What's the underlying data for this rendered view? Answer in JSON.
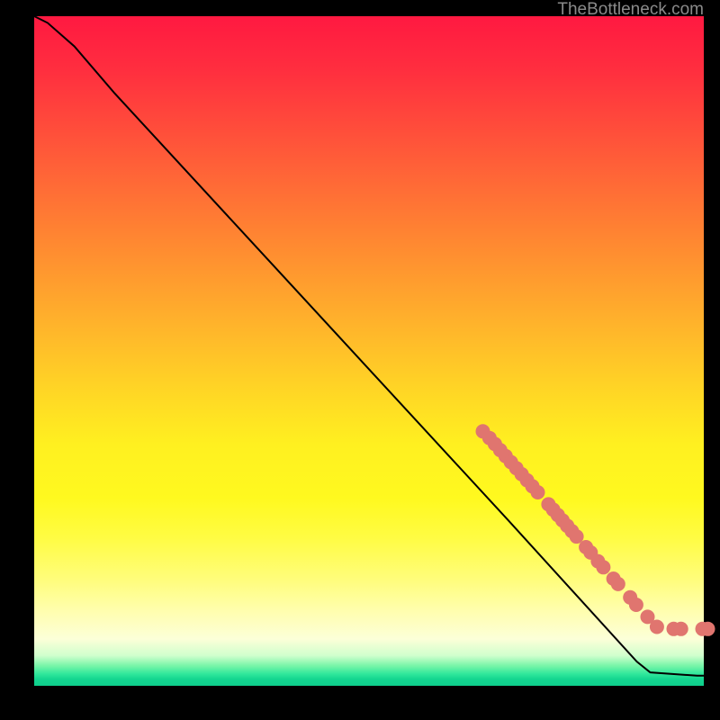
{
  "watermark": "TheBottleneck.com",
  "colors": {
    "background_black": "#000000",
    "curve_stroke": "#000000",
    "marker_fill": "#e0756f",
    "watermark_text": "#8a8a8a"
  },
  "chart_data": {
    "type": "line",
    "title": "",
    "xlabel": "",
    "ylabel": "",
    "xlim": [
      0,
      100
    ],
    "ylim": [
      0,
      100
    ],
    "grid": false,
    "note": "Axes are unlabeled; values below are percentage positions read off pixel coordinates relative to plot area.",
    "curve": [
      {
        "x": 0.0,
        "y": 100.0
      },
      {
        "x": 2.0,
        "y": 99.0
      },
      {
        "x": 6.0,
        "y": 95.5
      },
      {
        "x": 12.0,
        "y": 88.5
      },
      {
        "x": 70.8,
        "y": 24.7
      },
      {
        "x": 90.0,
        "y": 3.6
      },
      {
        "x": 92.0,
        "y": 2.0
      },
      {
        "x": 99.0,
        "y": 1.5
      },
      {
        "x": 100.0,
        "y": 1.5
      }
    ],
    "markers": [
      {
        "x": 67.0,
        "y": 38.0
      },
      {
        "x": 68.0,
        "y": 37.0
      },
      {
        "x": 68.8,
        "y": 36.1
      },
      {
        "x": 69.6,
        "y": 35.2
      },
      {
        "x": 70.4,
        "y": 34.3
      },
      {
        "x": 71.2,
        "y": 33.4
      },
      {
        "x": 72.0,
        "y": 32.5
      },
      {
        "x": 72.8,
        "y": 31.6
      },
      {
        "x": 73.6,
        "y": 30.7
      },
      {
        "x": 74.4,
        "y": 29.8
      },
      {
        "x": 75.2,
        "y": 28.9
      },
      {
        "x": 76.8,
        "y": 27.1
      },
      {
        "x": 77.5,
        "y": 26.3
      },
      {
        "x": 78.2,
        "y": 25.5
      },
      {
        "x": 78.9,
        "y": 24.7
      },
      {
        "x": 79.6,
        "y": 23.9
      },
      {
        "x": 80.3,
        "y": 23.1
      },
      {
        "x": 81.0,
        "y": 22.3
      },
      {
        "x": 82.4,
        "y": 20.7
      },
      {
        "x": 83.1,
        "y": 19.9
      },
      {
        "x": 84.2,
        "y": 18.6
      },
      {
        "x": 85.0,
        "y": 17.7
      },
      {
        "x": 86.5,
        "y": 16.0
      },
      {
        "x": 87.2,
        "y": 15.2
      },
      {
        "x": 89.0,
        "y": 13.2
      },
      {
        "x": 89.9,
        "y": 12.1
      },
      {
        "x": 91.6,
        "y": 10.3
      },
      {
        "x": 93.0,
        "y": 8.8
      },
      {
        "x": 95.5,
        "y": 8.5
      },
      {
        "x": 96.6,
        "y": 8.5
      },
      {
        "x": 99.8,
        "y": 8.5
      },
      {
        "x": 100.6,
        "y": 8.5
      }
    ],
    "marker_radius_px": 8
  }
}
